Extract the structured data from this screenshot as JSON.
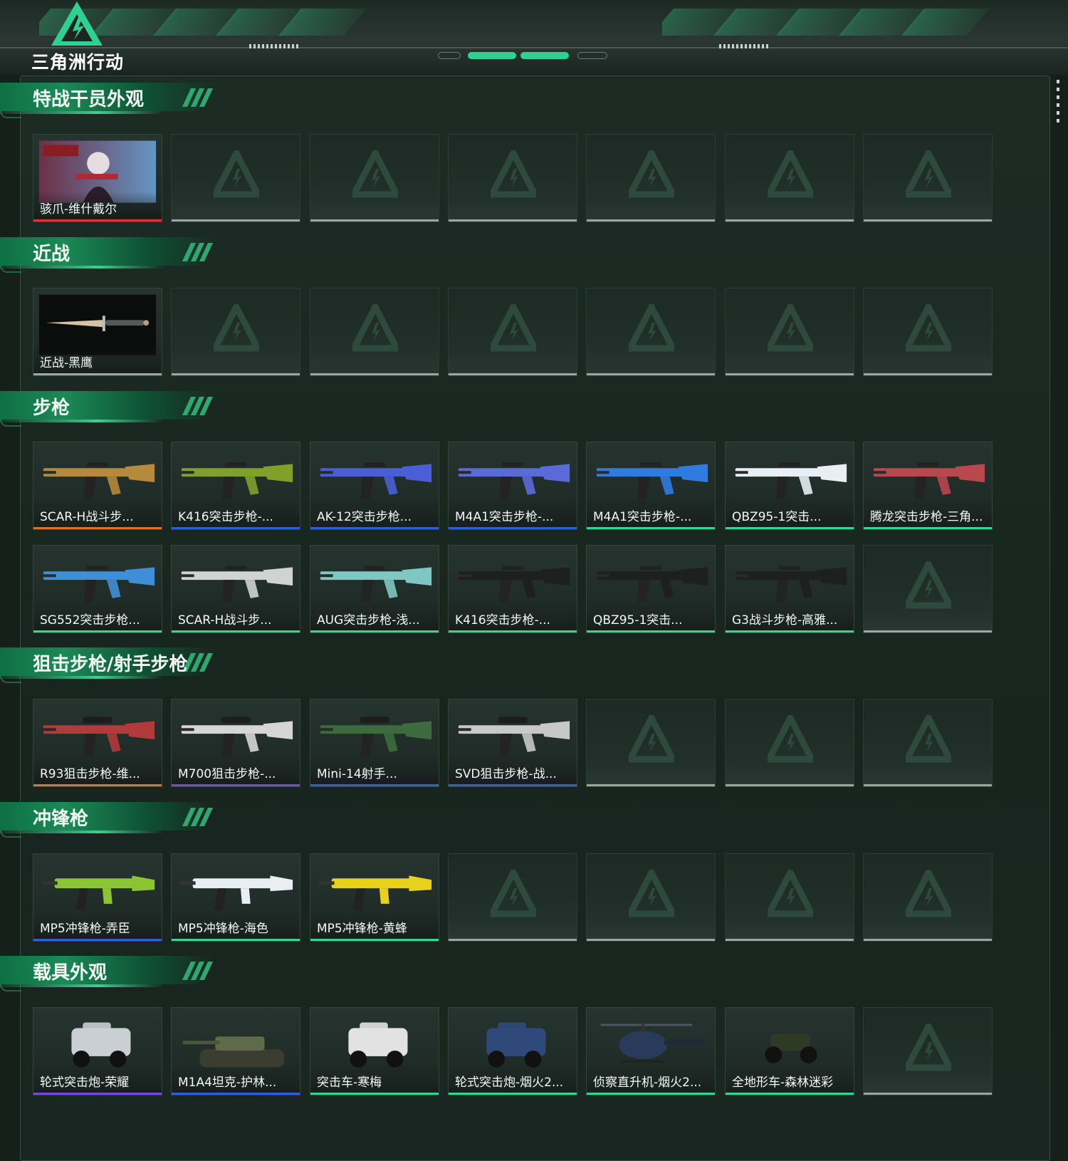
{
  "app": {
    "logo_text": "三角洲行动"
  },
  "colors": {
    "orange": "#e0702a",
    "red": "#e23232",
    "purple": "#7a45e0",
    "blue": "#2a5fe0",
    "green": "#32d98d",
    "gray": "#9da6a2"
  },
  "sections": [
    {
      "title": "特战干员外观",
      "rows": [
        [
          {
            "label": "骇爪-维什戴尔",
            "rarity": "red",
            "art": "portrait"
          },
          null,
          null,
          null,
          null,
          null,
          null
        ]
      ]
    },
    {
      "title": "近战",
      "rows": [
        [
          {
            "label": "近战-黑鹰",
            "rarity": "gray",
            "art": "knife"
          },
          null,
          null,
          null,
          null,
          null,
          null
        ]
      ]
    },
    {
      "title": "步枪",
      "rows": [
        [
          {
            "label": "SCAR-H战斗步...",
            "rarity": "orange",
            "art": "rifle",
            "tint": "#b58a3c"
          },
          {
            "label": "K416突击步枪-...",
            "rarity": "blue",
            "art": "rifle",
            "tint": "#7fa12a"
          },
          {
            "label": "AK-12突击步枪...",
            "rarity": "blue",
            "art": "rifle",
            "tint": "#4a5fd6"
          },
          {
            "label": "M4A1突击步枪-...",
            "rarity": "blue",
            "art": "rifle",
            "tint": "#5a6ad8"
          },
          {
            "label": "M4A1突击步枪-...",
            "rarity": "green",
            "art": "rifle",
            "tint": "#2f7be0"
          },
          {
            "label": "QBZ95-1突击...",
            "rarity": "green",
            "art": "rifle",
            "tint": "#e8eef3"
          },
          {
            "label": "腾龙突击步枪-三角...",
            "rarity": "green",
            "art": "rifle",
            "tint": "#b8474e"
          }
        ],
        [
          {
            "label": "SG552突击步枪...",
            "rarity": "green",
            "art": "rifle",
            "tint": "#3f8fd8"
          },
          {
            "label": "SCAR-H战斗步...",
            "rarity": "green",
            "art": "rifle",
            "tint": "#cfd3d2"
          },
          {
            "label": "AUG突击步枪-浅...",
            "rarity": "green",
            "art": "rifle",
            "tint": "#7fc7c2"
          },
          {
            "label": "K416突击步枪-...",
            "rarity": "green",
            "art": "rifle",
            "tint": "#1e1f1f"
          },
          {
            "label": "QBZ95-1突击...",
            "rarity": "green",
            "art": "rifle",
            "tint": "#1e1f1f"
          },
          {
            "label": "G3战斗步枪-高雅...",
            "rarity": "green",
            "art": "rifle",
            "tint": "#1e1f1f"
          },
          null
        ]
      ]
    },
    {
      "title": "狙击步枪/射手步枪",
      "rows": [
        [
          {
            "label": "R93狙击步枪-维...",
            "rarity": "orange",
            "art": "sniper",
            "tint": "#b13a3a"
          },
          {
            "label": "M700狙击步枪-...",
            "rarity": "purple",
            "art": "sniper",
            "tint": "#d6d6d6"
          },
          {
            "label": "Mini-14射手...",
            "rarity": "blue",
            "art": "sniper",
            "tint": "#3d6b3f"
          },
          {
            "label": "SVD狙击步枪-战...",
            "rarity": "blue",
            "art": "sniper",
            "tint": "#c8c8c8"
          },
          null,
          null,
          null
        ]
      ]
    },
    {
      "title": "冲锋枪",
      "rows": [
        [
          {
            "label": "MP5冲锋枪-弄臣",
            "rarity": "blue",
            "art": "smg",
            "tint": "#8cc534"
          },
          {
            "label": "MP5冲锋枪-海色",
            "rarity": "green",
            "art": "smg",
            "tint": "#e9eef3"
          },
          {
            "label": "MP5冲锋枪-黄蜂",
            "rarity": "green",
            "art": "smg",
            "tint": "#e6d11f"
          },
          null,
          null,
          null,
          null
        ]
      ]
    },
    {
      "title": "载具外观",
      "rows": [
        [
          {
            "label": "轮式突击炮-荣耀",
            "rarity": "purple",
            "art": "vehicle",
            "tint": "#c9cfd2"
          },
          {
            "label": "M1A4坦克-护林...",
            "rarity": "blue",
            "art": "tank",
            "tint": "#5f6a4a"
          },
          {
            "label": "突击车-寒梅",
            "rarity": "green",
            "art": "vehicle",
            "tint": "#e2e2e2"
          },
          {
            "label": "轮式突击炮-烟火2...",
            "rarity": "green",
            "art": "vehicle",
            "tint": "#2f4a7a"
          },
          {
            "label": "侦察直升机-烟火2...",
            "rarity": "green",
            "art": "heli",
            "tint": "#2a3a5a"
          },
          {
            "label": "全地形车-森林迷彩",
            "rarity": "green",
            "art": "atv",
            "tint": "#2f3a26"
          },
          null
        ]
      ]
    }
  ]
}
